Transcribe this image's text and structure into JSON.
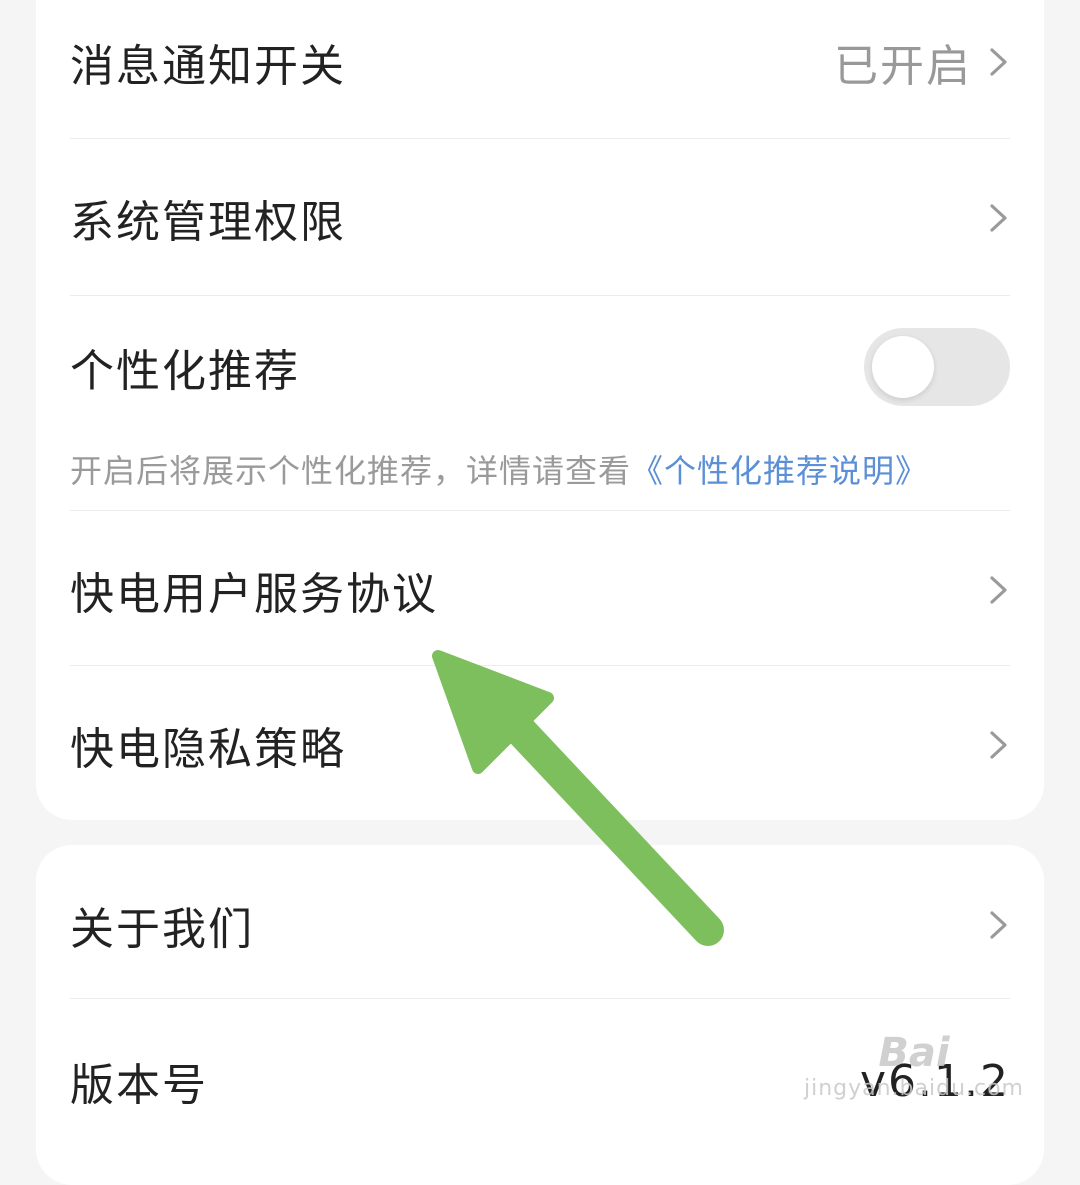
{
  "settings": {
    "notification": {
      "label": "消息通知开关",
      "value": "已开启"
    },
    "system_permission": {
      "label": "系统管理权限"
    },
    "personalized": {
      "label": "个性化推荐",
      "toggle_on": false,
      "description": "开启后将展示个性化推荐，详情请查看",
      "link": "《个性化推荐说明》"
    },
    "user_agreement": {
      "label": "快电用户服务协议"
    },
    "privacy_policy": {
      "label": "快电隐私策略"
    }
  },
  "about": {
    "about_us": {
      "label": "关于我们"
    },
    "version": {
      "label": "版本号",
      "value": "v6.1.2"
    }
  },
  "watermark": {
    "brand": "Bai",
    "site": "jingyan.baidu.com"
  },
  "colors": {
    "arrow": "#7dbf5c",
    "link": "#5b8fd6",
    "toggle_off": "#e6e6e6",
    "muted_text": "#999999"
  }
}
